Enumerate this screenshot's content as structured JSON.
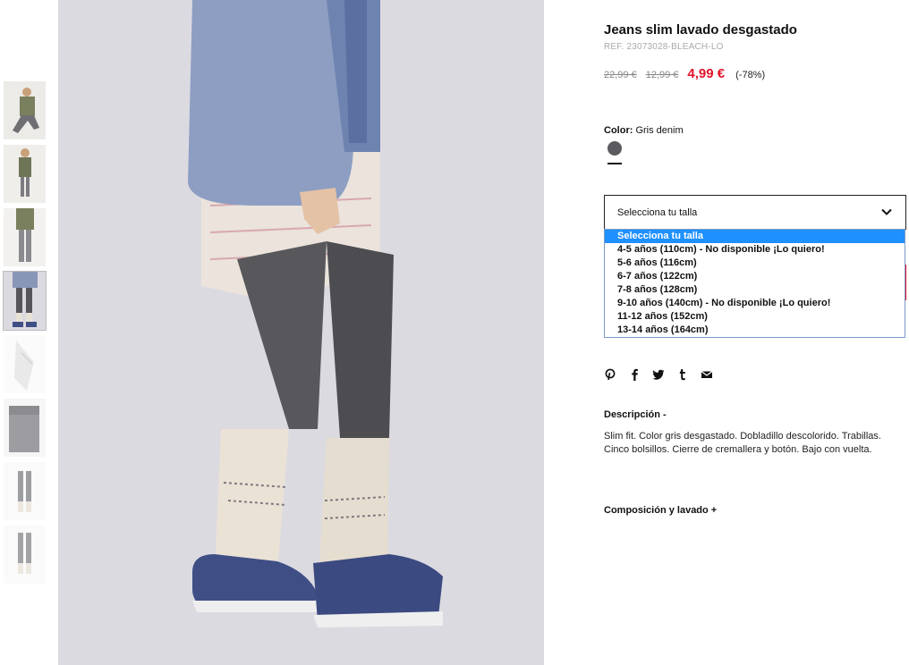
{
  "product": {
    "title": "Jeans slim lavado desgastado",
    "ref": "REF. 23073028-BLEACH-LO",
    "price_original": "22,99 €",
    "price_previous": "12,99 €",
    "price_current": "4,99 €",
    "discount": "(-78%)",
    "price_color": "#e3132c"
  },
  "color": {
    "label": "Color:",
    "value": "Gris denim",
    "swatch": "#5b5b5f"
  },
  "size": {
    "select_label": "Selecciona tu talla",
    "options": [
      "Selecciona tu talla",
      "4-5 años (110cm) - No disponible ¡Lo quiero!",
      "5-6 años (116cm)",
      "6-7 años (122cm)",
      "7-8 años (128cm)",
      "9-10 años (140cm) - No disponible ¡Lo quiero!",
      "11-12 años (152cm)",
      "13-14 años (164cm)"
    ]
  },
  "share_icons": [
    "pinterest-icon",
    "facebook-icon",
    "twitter-icon",
    "tumblr-icon",
    "email-icon"
  ],
  "description": {
    "heading": "Descripción -",
    "body": "Slim fit. Color gris desgastado. Dobladillo descolorido. Trabillas. Cinco bolsillos. Cierre de cremallera y botón. Bajo con vuelta."
  },
  "composition": {
    "heading": "Composición y lavado +"
  }
}
